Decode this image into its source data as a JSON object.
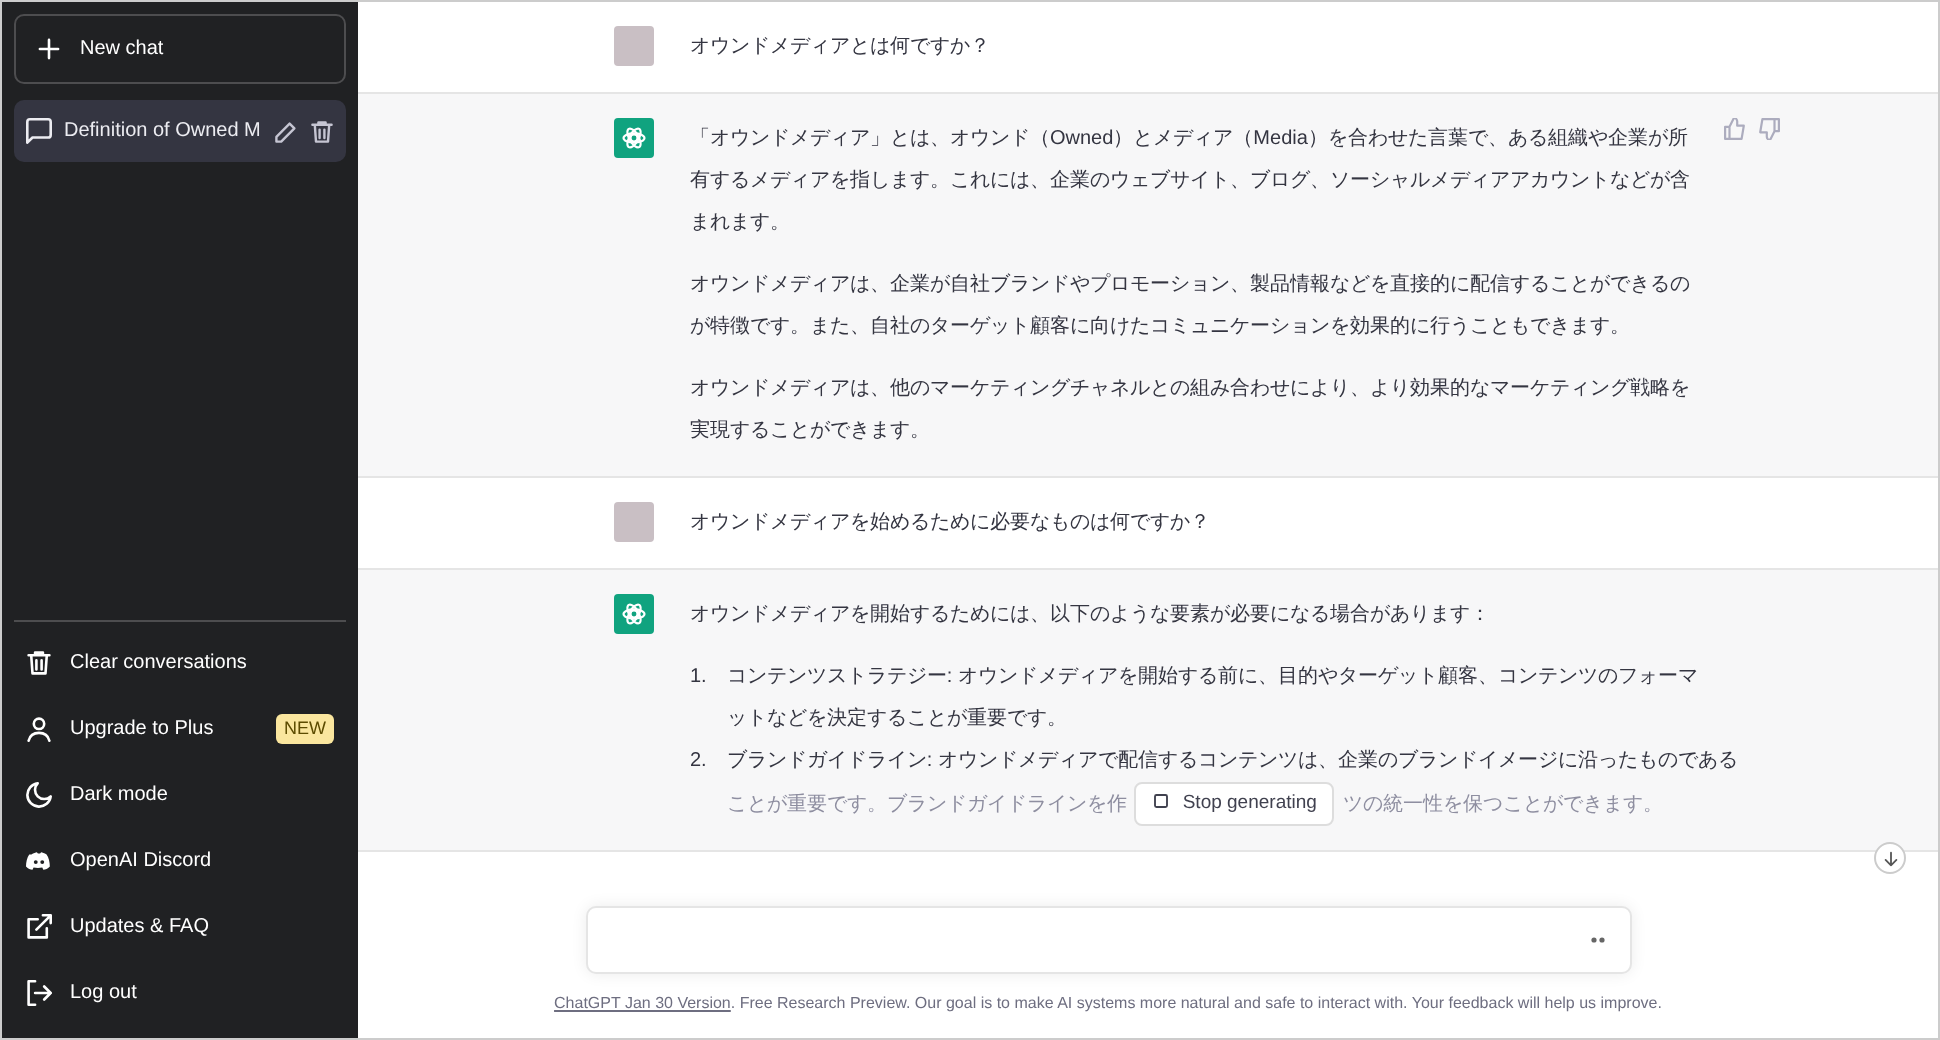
{
  "sidebar": {
    "new_chat": "New chat",
    "chats": [
      {
        "title": "Definition of Owned M",
        "selected": true
      }
    ],
    "menu": [
      {
        "label": "Clear conversations"
      },
      {
        "label": "Upgrade to Plus",
        "badge": "NEW"
      },
      {
        "label": "Dark mode"
      },
      {
        "label": "OpenAI Discord"
      },
      {
        "label": "Updates & FAQ"
      },
      {
        "label": "Log out"
      }
    ]
  },
  "messages": [
    {
      "kind": "user",
      "paragraphs": [
        "オウンドメディアとは何ですか？"
      ]
    },
    {
      "kind": "assistant",
      "feedback": true,
      "paragraphs": [
        "「オウンドメディア」とは、オウンド（Owned）とメディア（Media）を合わせた言葉で、ある組織や企業が所有するメディアを指します。これには、企業のウェブサイト、ブログ、ソーシャルメディアアカウントなどが含まれます。",
        "オウンドメディアは、企業が自社ブランドやプロモーション、製品情報などを直接的に配信することができるのが特徴です。また、自社のターゲット顧客に向けたコミュニケーションを効果的に行うこともできます。",
        "オウンドメディアは、他のマーケティングチャネルとの組み合わせにより、より効果的なマーケティング戦略を実現することができます。"
      ]
    },
    {
      "kind": "user",
      "paragraphs": [
        "オウンドメディアを始めるために必要なものは何ですか？"
      ]
    },
    {
      "kind": "assistant",
      "feedback": false,
      "paragraphs": [
        "オウンドメディアを開始するためには、以下のような要素が必要になる場合があります："
      ],
      "list": [
        {
          "number": "1.",
          "text": "コンテンツストラテジー: オウンドメディアを開始する前に、目的やターゲット顧客、コンテンツのフォーマットなどを決定することが重要です。"
        },
        {
          "number": "2.",
          "text": "ブランドガイドライン: オウンドメディアで配信するコンテンツは、企業のブランドイメージに沿ったものである",
          "lead": "ことが重要です。ブランドガイドラインを作",
          "tail": "ツの統一性を保つことができます。"
        }
      ]
    }
  ],
  "stop_button": "Stop generating",
  "footer": {
    "link": "ChatGPT Jan 30 Version",
    "text": ". Free Research Preview. Our goal is to make AI systems more natural and safe to interact with. Your feedback will help us improve."
  }
}
